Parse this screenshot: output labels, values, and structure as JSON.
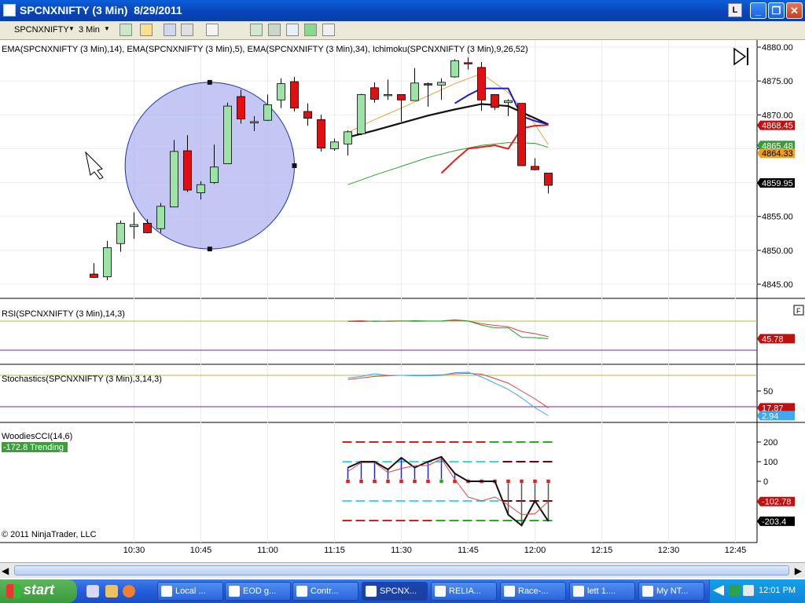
{
  "window": {
    "title": "SPCNXNIFTY (3 Min)  8/29/2011",
    "lock_label": "L",
    "minimize_label": "_",
    "restore_label": "❐",
    "close_label": "✕"
  },
  "toolbar": {
    "instrument": "SPCNXNIFTY",
    "interval": "3 Min",
    "icons": [
      "bar-style-icon",
      "pencil-icon",
      "pin-icon",
      "zoom-icon",
      "cursor-icon",
      "data-box-icon",
      "chart-properties-icon",
      "strategy-icon",
      "dollar-icon",
      "window-linking-icon"
    ]
  },
  "colors": {
    "up_candle": "#9de3a6",
    "down_candle": "#e01010",
    "ellipse_fill": "#b0b4f0",
    "ellipse_stroke": "#2030a0",
    "ema14": "#111111",
    "ema5": "#e8a040",
    "ema34": "#30a030",
    "ichimoku_red": "#e02020",
    "ichimoku_blue": "#1a1ad0",
    "rsi_line": "#e04040",
    "rsi_avg": "#20a020",
    "stoch_d": "#e04040",
    "stoch_k": "#40a8f0"
  },
  "chart_data": [
    {
      "type": "candlestick",
      "title": "",
      "indicators_label": "EMA(SPCNXNIFTY (3 Min),14), EMA(SPCNXNIFTY (3 Min),5), EMA(SPCNXNIFTY (3 Min),34),  Ichimoku(SPCNXNIFTY (3 Min),9,26,52)",
      "ylim": [
        4843,
        4881
      ],
      "yticks": [
        4845,
        4850,
        4855,
        4860,
        4865,
        4870,
        4875,
        4880
      ],
      "ytick_labels": [
        "4845.00",
        "4850.00",
        "4855.00",
        "4860.00",
        "4865.00",
        "4870.00",
        "4875.00",
        "4880.00"
      ],
      "xticks": [
        "10:30",
        "10:45",
        "11:00",
        "11:15",
        "11:30",
        "11:45",
        "12:00",
        "12:15",
        "12:30",
        "12:45"
      ],
      "x_minutes": [
        630,
        645,
        660,
        675,
        690,
        705,
        720,
        735,
        750,
        765
      ],
      "candles": [
        {
          "t": 621,
          "o": 4846.5,
          "h": 4848.1,
          "l": 4846.0,
          "c": 4846.0
        },
        {
          "t": 624,
          "o": 4846.1,
          "h": 4851.4,
          "l": 4845.6,
          "c": 4850.4
        },
        {
          "t": 627,
          "o": 4851.0,
          "h": 4854.4,
          "l": 4849.8,
          "c": 4854.0
        },
        {
          "t": 630,
          "o": 4853.5,
          "h": 4855.6,
          "l": 4851.7,
          "c": 4853.8
        },
        {
          "t": 633,
          "o": 4854.0,
          "h": 4854.6,
          "l": 4852.5,
          "c": 4852.6
        },
        {
          "t": 636,
          "o": 4853.2,
          "h": 4857.0,
          "l": 4852.6,
          "c": 4856.5
        },
        {
          "t": 639,
          "o": 4856.4,
          "h": 4866.3,
          "l": 4856.4,
          "c": 4864.6
        },
        {
          "t": 642,
          "o": 4864.7,
          "h": 4867.0,
          "l": 4858.6,
          "c": 4858.9
        },
        {
          "t": 645,
          "o": 4858.5,
          "h": 4860.2,
          "l": 4857.5,
          "c": 4859.7
        },
        {
          "t": 648,
          "o": 4860.0,
          "h": 4865.6,
          "l": 4859.8,
          "c": 4862.3
        },
        {
          "t": 651,
          "o": 4862.8,
          "h": 4871.8,
          "l": 4862.8,
          "c": 4871.3
        },
        {
          "t": 654,
          "o": 4872.7,
          "h": 4873.7,
          "l": 4868.7,
          "c": 4869.4
        },
        {
          "t": 657,
          "o": 4868.8,
          "h": 4869.8,
          "l": 4867.6,
          "c": 4869.0
        },
        {
          "t": 660,
          "o": 4869.2,
          "h": 4873.0,
          "l": 4869.1,
          "c": 4871.5
        },
        {
          "t": 663,
          "o": 4872.2,
          "h": 4875.4,
          "l": 4871.0,
          "c": 4874.6
        },
        {
          "t": 666,
          "o": 4874.9,
          "h": 4875.6,
          "l": 4870.5,
          "c": 4871.0
        },
        {
          "t": 669,
          "o": 4870.5,
          "h": 4871.7,
          "l": 4868.4,
          "c": 4869.5
        },
        {
          "t": 672,
          "o": 4869.3,
          "h": 4870.0,
          "l": 4864.6,
          "c": 4865.1
        },
        {
          "t": 675,
          "o": 4865.0,
          "h": 4866.5,
          "l": 4864.7,
          "c": 4866.0
        },
        {
          "t": 678,
          "o": 4865.7,
          "h": 4867.7,
          "l": 4864.0,
          "c": 4867.5
        },
        {
          "t": 681,
          "o": 4867.2,
          "h": 4873.1,
          "l": 4867.0,
          "c": 4873.0
        },
        {
          "t": 684,
          "o": 4874.0,
          "h": 4874.8,
          "l": 4871.8,
          "c": 4872.3
        },
        {
          "t": 687,
          "o": 4873.0,
          "h": 4875.2,
          "l": 4872.2,
          "c": 4873.0
        },
        {
          "t": 690,
          "o": 4873.0,
          "h": 4873.0,
          "l": 4869.0,
          "c": 4872.2
        },
        {
          "t": 693,
          "o": 4872.1,
          "h": 4876.9,
          "l": 4872.1,
          "c": 4874.7
        },
        {
          "t": 696,
          "o": 4874.6,
          "h": 4874.8,
          "l": 4871.2,
          "c": 4874.4
        },
        {
          "t": 699,
          "o": 4874.4,
          "h": 4875.4,
          "l": 4872.2,
          "c": 4874.8
        },
        {
          "t": 702,
          "o": 4875.6,
          "h": 4878.2,
          "l": 4875.5,
          "c": 4878.0
        },
        {
          "t": 705,
          "o": 4877.7,
          "h": 4878.5,
          "l": 4876.7,
          "c": 4877.6
        },
        {
          "t": 708,
          "o": 4877.0,
          "h": 4877.8,
          "l": 4870.6,
          "c": 4872.2
        },
        {
          "t": 711,
          "o": 4873.0,
          "h": 4873.0,
          "l": 4870.7,
          "c": 4871.1
        },
        {
          "t": 714,
          "o": 4871.8,
          "h": 4872.3,
          "l": 4869.8,
          "c": 4872.1
        },
        {
          "t": 717,
          "o": 4871.7,
          "h": 4871.7,
          "l": 4862.5,
          "c": 4862.5
        },
        {
          "t": 720,
          "o": 4862.4,
          "h": 4863.6,
          "l": 4861.8,
          "c": 4861.9
        },
        {
          "t": 723,
          "o": 4861.4,
          "h": 4861.4,
          "l": 4858.4,
          "c": 4859.6
        }
      ],
      "ema14": {
        "t": [
          678,
          684,
          690,
          696,
          702,
          708,
          714,
          720,
          723
        ],
        "v": [
          4866.7,
          4867.7,
          4868.8,
          4869.9,
          4870.8,
          4871.6,
          4871.3,
          4869.5,
          4868.6
        ]
      },
      "ema5": {
        "t": [
          678,
          684,
          690,
          696,
          702,
          708,
          714,
          720,
          723
        ],
        "v": [
          4867.4,
          4869.3,
          4871.0,
          4872.8,
          4874.6,
          4876.1,
          4873.3,
          4868.6,
          4865.6
        ]
      },
      "ema34": {
        "t": [
          678,
          684,
          690,
          696,
          702,
          708,
          714,
          720,
          723
        ],
        "v": [
          4859.7,
          4861.1,
          4862.4,
          4863.7,
          4864.7,
          4865.5,
          4865.9,
          4865.8,
          4865.2
        ]
      },
      "ichimoku_red": {
        "t": [
          699,
          702,
          705,
          711,
          714,
          717,
          720,
          723
        ],
        "v": [
          4861.4,
          4863.3,
          4865.0,
          4865.5,
          4865.0,
          4868.0,
          4868.4,
          4868.5
        ]
      },
      "ichimoku_blue": {
        "t": [
          702,
          705,
          708,
          711,
          714,
          717,
          720,
          723
        ],
        "v": [
          4871.7,
          4872.9,
          4873.9,
          4873.9,
          4873.9,
          4869.8,
          4869.1,
          4868.6
        ]
      },
      "ellipse": {
        "center_t": 647,
        "center_v": 4862.5,
        "rx_minutes": 19,
        "ry_value": 12.3
      },
      "price_markers": [
        {
          "label": "4868.45",
          "value": 4868.45,
          "bg": "#c01010",
          "fg": "#ffffff"
        },
        {
          "label": "4865.48",
          "value": 4865.48,
          "bg": "#3a9a3a",
          "fg": "#ffffff"
        },
        {
          "label": "4864.33",
          "value": 4864.33,
          "bg": "#f0a020",
          "fg": "#000000"
        },
        {
          "label": "4859.95",
          "value": 4859.95,
          "bg": "#000000",
          "fg": "#ffffff"
        }
      ]
    },
    {
      "type": "line",
      "title": "RSI(SPCNXNIFTY (3 Min),14,3)",
      "ylim": [
        0,
        100
      ],
      "levels": [
        {
          "value": 70,
          "color": "#a8c040"
        },
        {
          "value": 30,
          "color": "#8020a0"
        }
      ],
      "x": [
        678,
        681,
        684,
        687,
        690,
        693,
        696,
        699,
        702,
        705,
        708,
        711,
        714,
        717,
        720,
        723
      ],
      "series": [
        {
          "name": "",
          "color": "#e04040",
          "values": [
            70.0,
            70.5,
            69.6,
            70.1,
            70.3,
            69.7,
            70.0,
            70.2,
            71.2,
            70.0,
            66.4,
            64.0,
            62.3,
            55.7,
            52.7,
            48.7
          ]
        },
        {
          "name": "",
          "color": "#20a020",
          "values": [
            69.6,
            69.4,
            70.2,
            69.7,
            70.0,
            70.6,
            70.2,
            70.2,
            71.9,
            70.3,
            64.4,
            60.7,
            60.7,
            47.7,
            47.3,
            45.8
          ]
        }
      ],
      "marker": {
        "label": "45.78",
        "value": 45.78,
        "bg": "#c01010",
        "fg": "#ffffff"
      }
    },
    {
      "type": "line",
      "title": "Stochastics(SPCNXNIFTY (3 Min),3,14,3)",
      "ylim": [
        0,
        100
      ],
      "yticks": [
        50
      ],
      "levels": [
        {
          "value": 80,
          "color": "#a8c040"
        },
        {
          "value": 20,
          "color": "#8020a0"
        }
      ],
      "x": [
        678,
        681,
        684,
        687,
        690,
        693,
        696,
        699,
        702,
        705,
        708,
        711,
        714,
        717,
        720,
        723
      ],
      "series": [
        {
          "name": "",
          "color": "#e04040",
          "values": [
            72,
            75,
            78,
            79,
            80,
            80,
            80,
            81,
            83,
            84,
            82,
            74,
            65,
            50,
            35,
            17.87
          ]
        },
        {
          "name": "",
          "color": "#40a8f0",
          "values": [
            75,
            78,
            83,
            80,
            80,
            79,
            79,
            80,
            85,
            86,
            77,
            65,
            53,
            37,
            18,
            2.94
          ]
        }
      ],
      "markers": [
        {
          "label": "17.87",
          "value": 17.87,
          "bg": "#c01010",
          "fg": "#ffffff"
        },
        {
          "label": "2.94",
          "value": 2.94,
          "bg": "#40a8f0",
          "fg": "#ffffff"
        }
      ]
    },
    {
      "type": "line",
      "title": "WoodiesCCI(14,6)",
      "status": "-172.8 Trending",
      "ylim": [
        -250,
        250
      ],
      "yticks": [
        200,
        100,
        0
      ],
      "ytick_labels": [
        "200",
        "100",
        "0"
      ],
      "x": [
        678,
        681,
        684,
        687,
        690,
        693,
        696,
        699,
        702,
        705,
        708,
        711,
        714,
        717,
        720,
        723
      ],
      "series": [
        {
          "name": "",
          "color": "#111111",
          "values": [
            70,
            100,
            100,
            60,
            120,
            70,
            100,
            125,
            40,
            0,
            0,
            0,
            -170,
            -225,
            -100,
            -203.4
          ]
        },
        {
          "name": "",
          "color": "#e04040",
          "values": [
            50,
            95,
            95,
            45,
            65,
            80,
            80,
            115,
            10,
            -80,
            -100,
            -80,
            -120,
            -170,
            -165,
            -102.78
          ]
        }
      ],
      "histogram": [
        70,
        100,
        100,
        60,
        120,
        70,
        100,
        125,
        40,
        0,
        0,
        0,
        -170,
        -225,
        -100,
        -203.4
      ],
      "dashed_levels": [
        {
          "value": 200,
          "segments": [
            {
              "from": 678,
              "to": 711,
              "color": "#d02020"
            },
            {
              "from": 711,
              "to": 726,
              "color": "#20b020"
            }
          ]
        },
        {
          "value": 100,
          "segments": [
            {
              "from": 678,
              "to": 714,
              "color": "#40d8e8"
            },
            {
              "from": 714,
              "to": 726,
              "color": "#800000"
            }
          ]
        },
        {
          "value": -100,
          "segments": [
            {
              "from": 678,
              "to": 714,
              "color": "#40d8e8"
            },
            {
              "from": 714,
              "to": 726,
              "color": "#800000"
            }
          ]
        },
        {
          "value": -200,
          "segments": [
            {
              "from": 678,
              "to": 699,
              "color": "#d02020"
            },
            {
              "from": 699,
              "to": 726,
              "color": "#20b020"
            }
          ]
        }
      ],
      "markers": [
        {
          "label": "-102.78",
          "value": -102.78,
          "bg": "#c01010",
          "fg": "#ffffff"
        },
        {
          "label": "-203.4",
          "value": -203.4,
          "bg": "#000000",
          "fg": "#ffffff"
        }
      ]
    }
  ],
  "footer": {
    "copyright": "© 2011 NinjaTrader, LLC"
  },
  "panel_button": "F",
  "taskbar": {
    "start_label": "start",
    "tasks": [
      "Local ...",
      "EOD g...",
      "Contr...",
      "SPCNX...",
      "RELIA...",
      "Race-...",
      "lett 1....",
      "My NT..."
    ],
    "active_task": 3,
    "clock": "12:01 PM"
  }
}
